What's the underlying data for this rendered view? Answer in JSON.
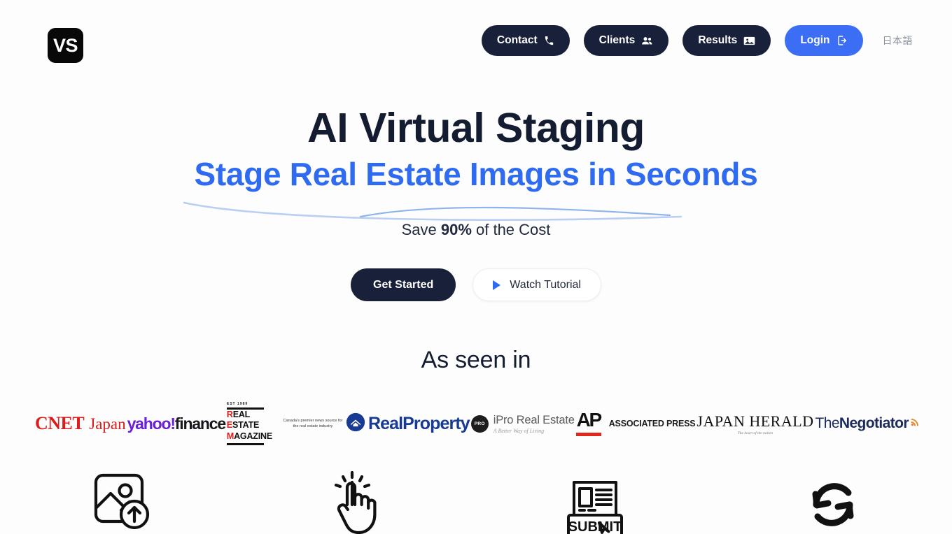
{
  "brand": {
    "logo_text": "VS",
    "logo_name": "vs-logo"
  },
  "nav": {
    "items": [
      {
        "label": "Contact",
        "icon": "phone-icon",
        "style": "dark"
      },
      {
        "label": "Clients",
        "icon": "people-icon",
        "style": "dark"
      },
      {
        "label": "Results",
        "icon": "image-icon",
        "style": "dark"
      },
      {
        "label": "Login",
        "icon": "logout-icon",
        "style": "primary"
      }
    ],
    "language_link": "日本語"
  },
  "hero": {
    "title": "AI Virtual Staging",
    "subtitle": "Stage Real Estate Images in Seconds",
    "save_prefix": "Save ",
    "save_value": "90%",
    "save_suffix": " of the Cost",
    "primary_cta": "Get Started",
    "secondary_cta": "Watch Tutorial",
    "secondary_cta_icon": "play-icon"
  },
  "press": {
    "heading": "As seen in",
    "logos": [
      {
        "name": "cnet-japan",
        "part1": "CNET",
        "part2": "Japan"
      },
      {
        "name": "yahoo-finance",
        "part1": "yahoo!",
        "part2": "finance"
      },
      {
        "name": "real-estate-magazine",
        "est": "EST 1989",
        "line1_accent": "R",
        "line1_rest": "EAL",
        "line2_accent": "E",
        "line2_rest": "STATE",
        "line3_accent": "M",
        "line3_rest": "AGAZINE",
        "tagline": "Canada's premier news source for the real estate industry"
      },
      {
        "name": "real-property",
        "text": "RealProperty"
      },
      {
        "name": "ipro-real-estate",
        "badge": "PRO",
        "text": "iPro Real Estate",
        "tagline": "A Better Way of Living"
      },
      {
        "name": "associated-press",
        "mark": "AP",
        "text": "ASSOCIATED PRESS"
      },
      {
        "name": "japan-herald",
        "text": "JAPAN HERALD",
        "tagline": "The heart of the nation"
      },
      {
        "name": "the-negotiator",
        "part1": "The",
        "part2": "Negotiator"
      }
    ]
  },
  "features": [
    {
      "icon": "image-upload-icon"
    },
    {
      "icon": "tap-hand-icon"
    },
    {
      "icon": "submit-document-icon"
    },
    {
      "icon": "refresh-cycle-icon"
    }
  ],
  "colors": {
    "accent_blue": "#3b6ef5",
    "subtitle_blue": "#2f6bf0",
    "dark": "#18203a",
    "background": "#fdfdfd"
  }
}
